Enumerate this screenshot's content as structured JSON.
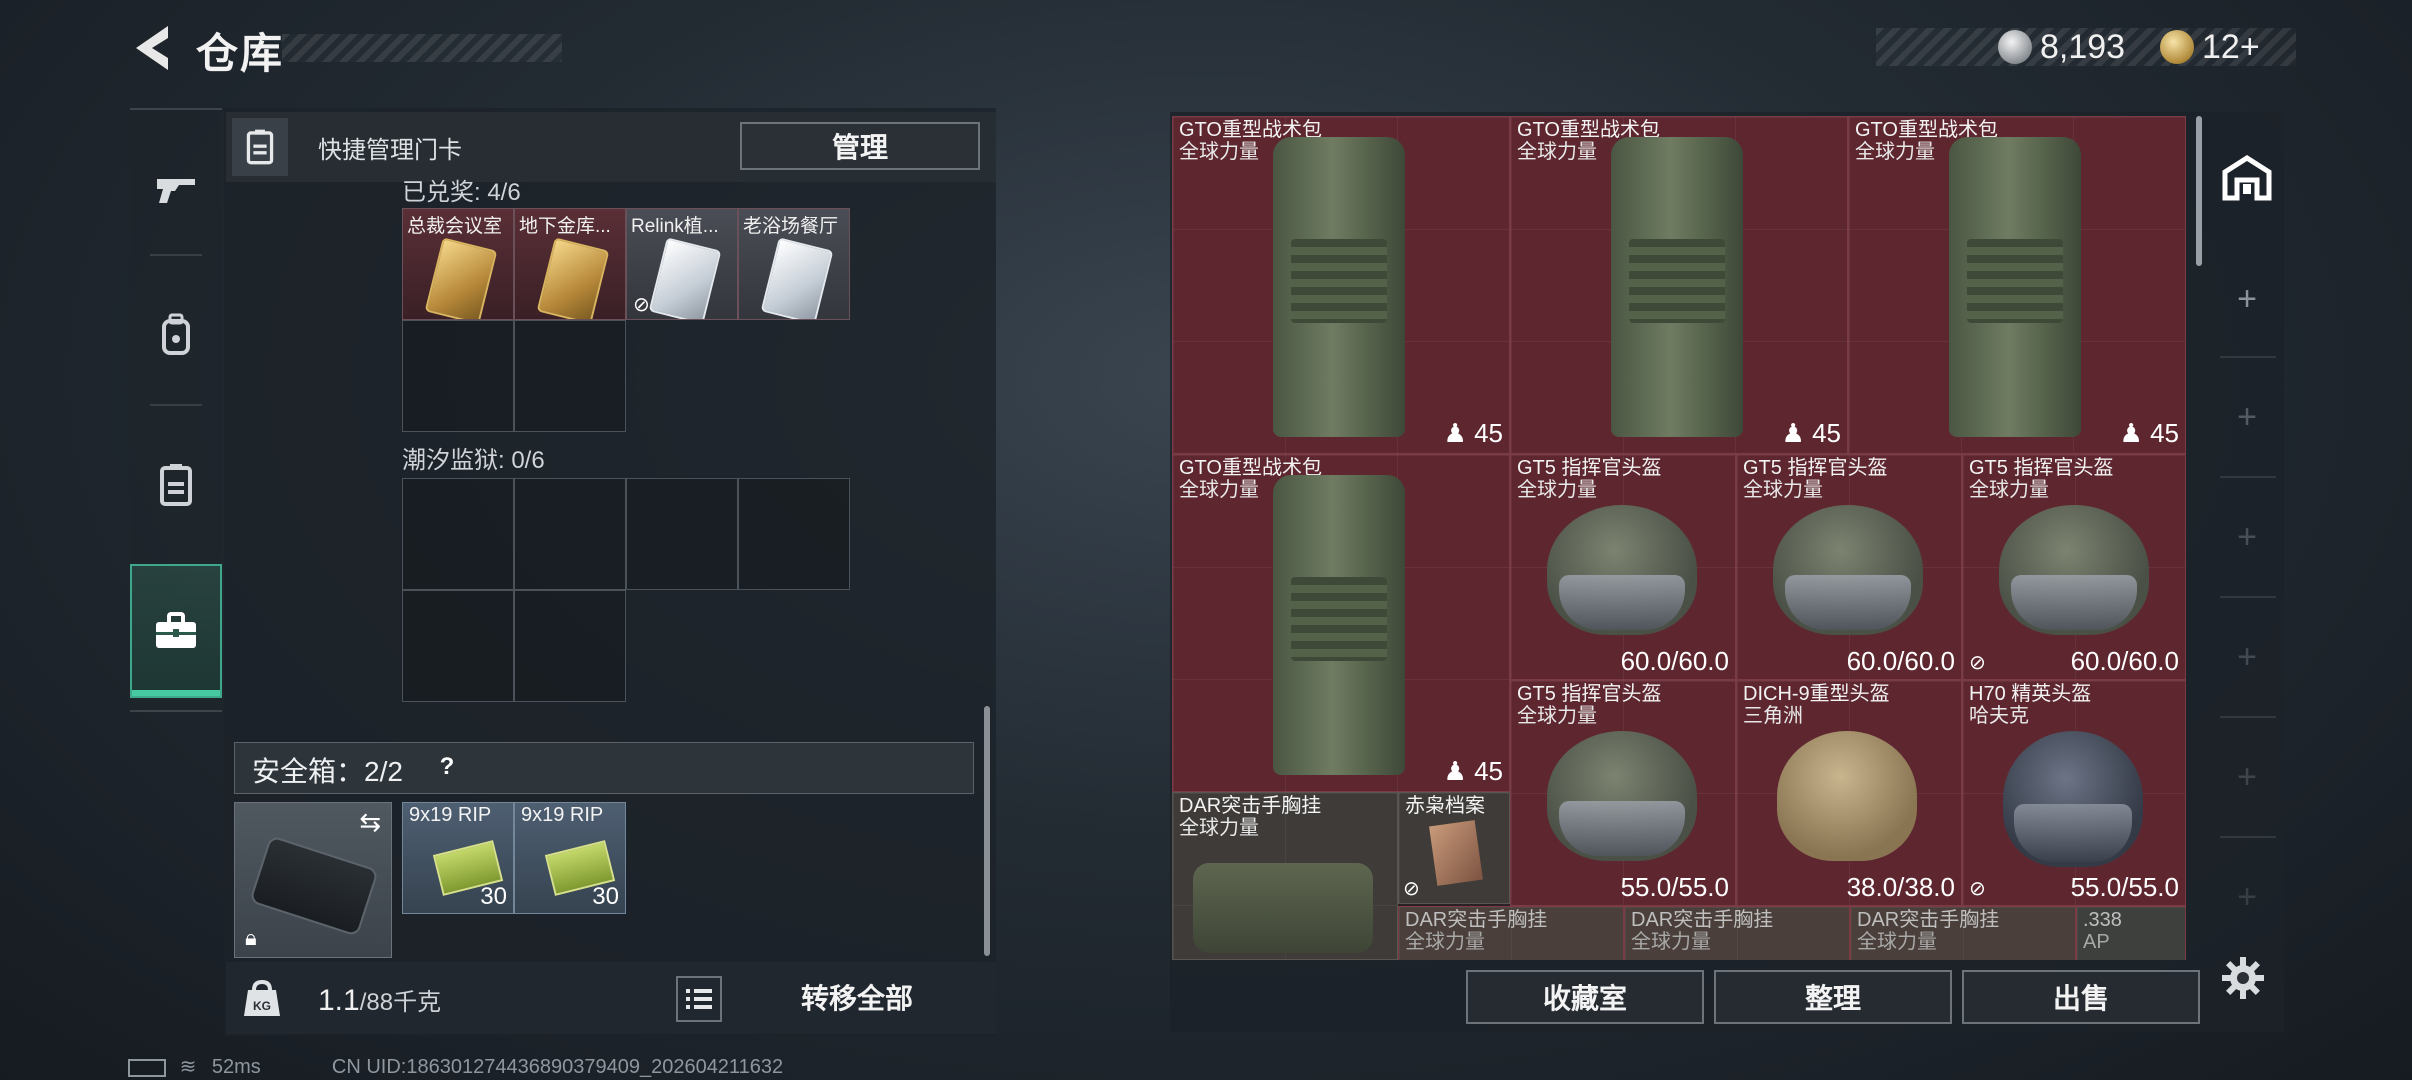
{
  "header": {
    "title": "仓库"
  },
  "currency": {
    "silver": "8,193",
    "gold": "12+"
  },
  "sidebar": {
    "items": [
      {
        "name": "weapon"
      },
      {
        "name": "backpack"
      },
      {
        "name": "keycard"
      },
      {
        "name": "toolbox"
      }
    ]
  },
  "left": {
    "quick_manage_label": "快捷管理门卡",
    "manage_btn": "管理",
    "section1_label": "已兑奖: 4/6",
    "section1_cards": [
      {
        "name": "总裁会议室",
        "type": "gold"
      },
      {
        "name": "地下金库...",
        "type": "gold"
      },
      {
        "name": "Relink植...",
        "type": "silver"
      },
      {
        "name": "老浴场餐厅",
        "type": "silver"
      }
    ],
    "section2_label": "潮汐监狱: 0/6",
    "safe_label": "安全箱：2/2",
    "safe_help": "?",
    "ammo": [
      {
        "name": "9x19 RIP",
        "count": "30"
      },
      {
        "name": "9x19 RIP",
        "count": "30"
      }
    ],
    "weight_value": "1.1",
    "weight_unit": "/88千克",
    "transfer_btn": "转移全部"
  },
  "status": {
    "ping": "52ms",
    "uid": "CN UID:186301274436890379409_202604211632"
  },
  "inventory": {
    "backpacks": [
      {
        "name": "GTO重型战术包",
        "sub": "全球力量",
        "count": "45"
      },
      {
        "name": "GTO重型战术包",
        "sub": "全球力量",
        "count": "45"
      },
      {
        "name": "GTO重型战术包",
        "sub": "全球力量",
        "count": "45"
      },
      {
        "name": "GTO重型战术包",
        "sub": "全球力量",
        "count": "45"
      }
    ],
    "helmets": [
      {
        "name": "GT5 指挥官头盔",
        "sub": "全球力量",
        "dur": "60.0/60.0"
      },
      {
        "name": "GT5 指挥官头盔",
        "sub": "全球力量",
        "dur": "60.0/60.0"
      },
      {
        "name": "GT5 指挥官头盔",
        "sub": "全球力量",
        "dur": "60.0/60.0"
      },
      {
        "name": "GT5 指挥官头盔",
        "sub": "全球力量",
        "dur": "55.0/55.0"
      },
      {
        "name": "DICH-9重型头盔",
        "sub": "三角洲",
        "dur": "38.0/38.0"
      },
      {
        "name": "H70 精英头盔",
        "sub": "哈夫克",
        "dur": "55.0/55.0"
      }
    ],
    "rig": {
      "name": "DAR突击手胸挂",
      "sub": "全球力量"
    },
    "file": {
      "name": "赤枭档案"
    },
    "bottom_row": [
      {
        "name": "DAR突击手胸挂",
        "sub": "全球力量"
      },
      {
        "name": "DAR突击手胸挂",
        "sub": "全球力量"
      },
      {
        "name": "DAR突击手胸挂",
        "sub": "全球力量"
      },
      {
        "name": ".338",
        "sub": "AP"
      }
    ]
  },
  "actions": {
    "collection": "收藏室",
    "organize": "整理",
    "sell": "出售"
  },
  "colors": {
    "item_bg": "#5e2730",
    "accent": "#46c9a0"
  }
}
